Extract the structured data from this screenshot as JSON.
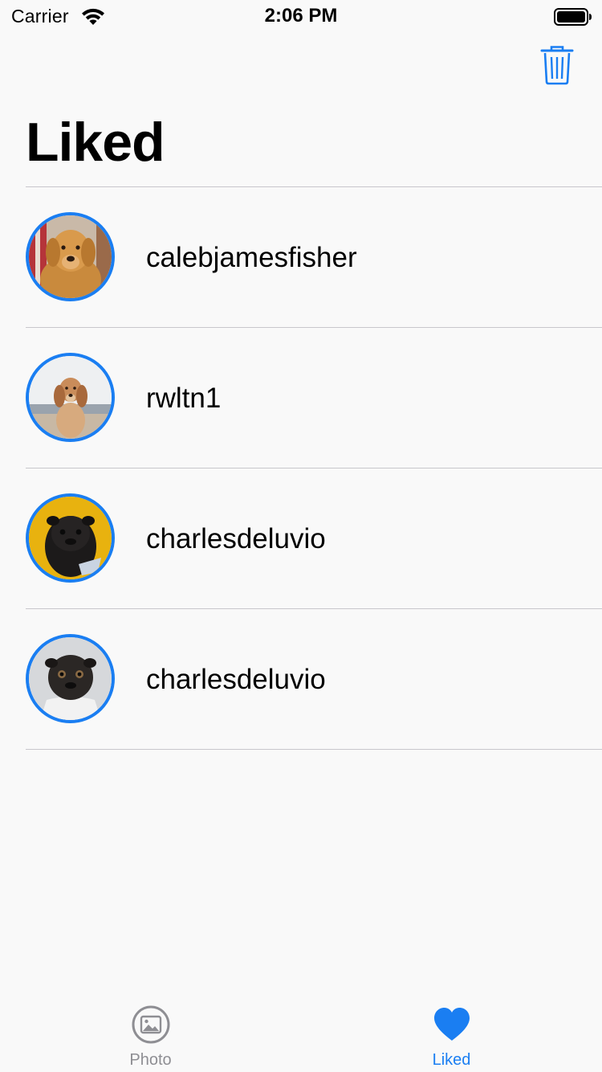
{
  "status_bar": {
    "carrier": "Carrier",
    "time": "2:06 PM",
    "wifi_icon": "wifi-icon",
    "battery_icon": "battery-icon"
  },
  "nav": {
    "title": "Liked",
    "trash_icon": "trash-icon"
  },
  "liked_list": [
    {
      "username": "calebjamesfisher",
      "avatar": "golden-retriever"
    },
    {
      "username": "rwltn1",
      "avatar": "spaniel-on-beach"
    },
    {
      "username": "charlesdeluvio",
      "avatar": "pug-yellow-background"
    },
    {
      "username": "charlesdeluvio",
      "avatar": "pug-gray-background"
    }
  ],
  "tab_bar": {
    "tabs": [
      {
        "label": "Photo",
        "icon": "photo-icon",
        "selected": false
      },
      {
        "label": "Liked",
        "icon": "heart-icon",
        "selected": true
      }
    ]
  },
  "colors": {
    "accent": "#1a7ef2",
    "inactive": "#8e8e93",
    "separator": "#c8c7cc",
    "background": "#f9f9f9"
  }
}
